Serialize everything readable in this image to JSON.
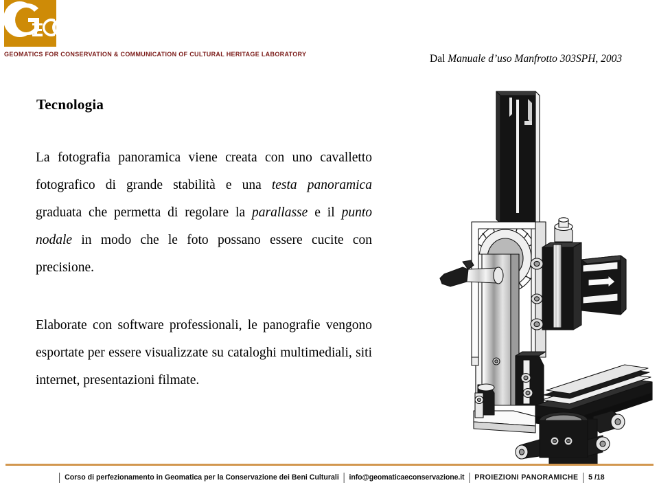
{
  "header": {
    "logo": {
      "name": "geco-logo",
      "wordmark": "GeCO",
      "square_color": "#CE8B07",
      "text_color": "#FFFFFF"
    },
    "lab_line": "GEOMATICS FOR CONSERVATION & COMMUNICATION OF CULTURAL HERITAGE LABORATORY",
    "lab_line_color": "#7A1A17",
    "source_ref": {
      "prefix": "Dal ",
      "italic_title": "Manuale d’uso Manfrotto 303SPH",
      "suffix": ", 2003"
    }
  },
  "slide": {
    "title": "Tecnologia",
    "paragraphs": [
      {
        "id": "para-1",
        "runs": [
          {
            "style": "roman",
            "text": "La fotografia panoramica viene creata con uno cavalletto fotografico di grande stabilità e una "
          },
          {
            "style": "italic",
            "text": "testa panoramica"
          },
          {
            "style": "roman",
            "text": " graduata che permetta di regolare la "
          },
          {
            "style": "italic",
            "text": "parallasse"
          },
          {
            "style": "roman",
            "text": " e il "
          },
          {
            "style": "italic",
            "text": "punto nodale"
          },
          {
            "style": "roman",
            "text": " in modo che le foto possano essere cucite con precisione."
          }
        ]
      },
      {
        "id": "para-2",
        "runs": [
          {
            "style": "roman",
            "text": "Elaborate con software professionali, le panografie vengono esportate per essere visualizzate su cataloghi multimediali, siti internet, presentazioni filmate."
          }
        ]
      }
    ]
  },
  "illustration": {
    "name": "manfrotto-303sph-panoramic-head-drawing",
    "caption_implied": "Manfrotto 303SPH panoramic head technical line drawing"
  },
  "footer": {
    "rule_color": "#D2974F",
    "course": "Corso di perfezionamento in Geomatica per la Conservazione dei Beni Culturali",
    "email": "info@geomaticaeconservazione.it",
    "section": "PROIEZIONI PANORAMICHE",
    "page_number": "5 /18",
    "separator": "|"
  }
}
